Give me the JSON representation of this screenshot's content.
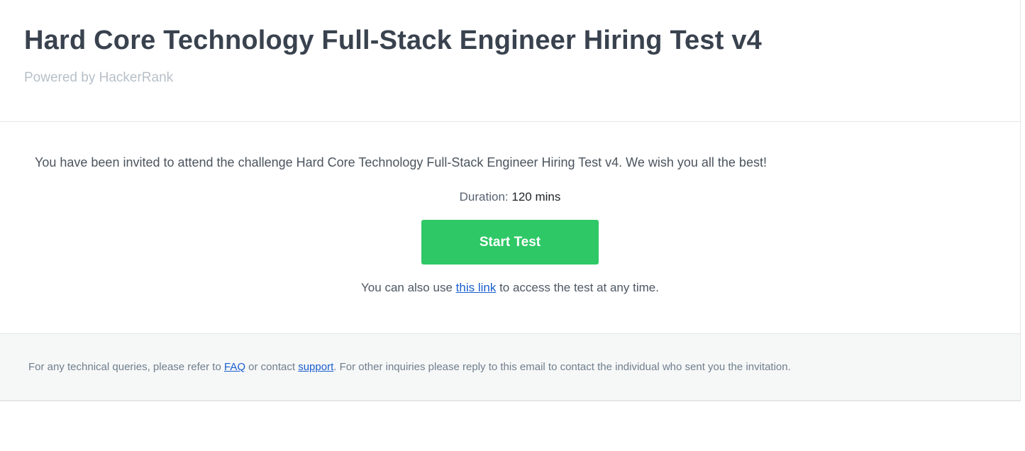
{
  "header": {
    "title": "Hard Core Technology Full-Stack Engineer Hiring Test v4",
    "subtitle": "Powered by HackerRank"
  },
  "main": {
    "invite_text": "You have been invited to attend the challenge Hard Core Technology Full-Stack Engineer Hiring Test v4. We wish you all the best!",
    "duration_label": "Duration:",
    "duration_value": "120 mins",
    "start_button_label": "Start Test",
    "link_prefix": "You can also use",
    "link_text": "this link",
    "link_suffix": "to access the test at any time."
  },
  "footer": {
    "text_1": "For any technical queries, please refer to",
    "faq_link": "FAQ",
    "text_2": "or contact",
    "support_link": "support",
    "text_3": ". For other inquiries please reply to this email to contact the individual who sent you the invitation."
  },
  "colors": {
    "accent_green": "#2ec866",
    "link_blue": "#1a5ecf",
    "title_text": "#39424e",
    "footer_bg": "#f6f7f7"
  }
}
